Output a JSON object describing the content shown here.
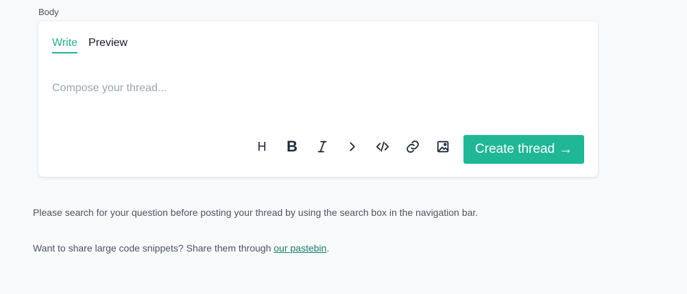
{
  "form": {
    "body_label": "Body"
  },
  "editor": {
    "tabs": [
      {
        "label": "Write",
        "active": true
      },
      {
        "label": "Preview",
        "active": false
      }
    ],
    "compose": {
      "placeholder": "Compose your thread...",
      "value": ""
    },
    "toolbar": {
      "heading_label": "H",
      "bold_label": "B",
      "icons": [
        "heading-icon",
        "bold-icon",
        "italic-icon",
        "quote-icon",
        "code-icon",
        "link-icon",
        "image-icon"
      ]
    },
    "submit": {
      "label": "Create thread",
      "arrow": "→"
    }
  },
  "help": {
    "search_note": "Please search for your question before posting your thread by using the search box in the navigation bar.",
    "pastebin_prefix": "Want to share large code snippets? Share them through ",
    "pastebin_link": "our pastebin",
    "pastebin_suffix": "."
  },
  "colors": {
    "accent": "#1fb193",
    "button": "#20b796",
    "link": "#167d6a",
    "background": "#f8f9fa"
  }
}
